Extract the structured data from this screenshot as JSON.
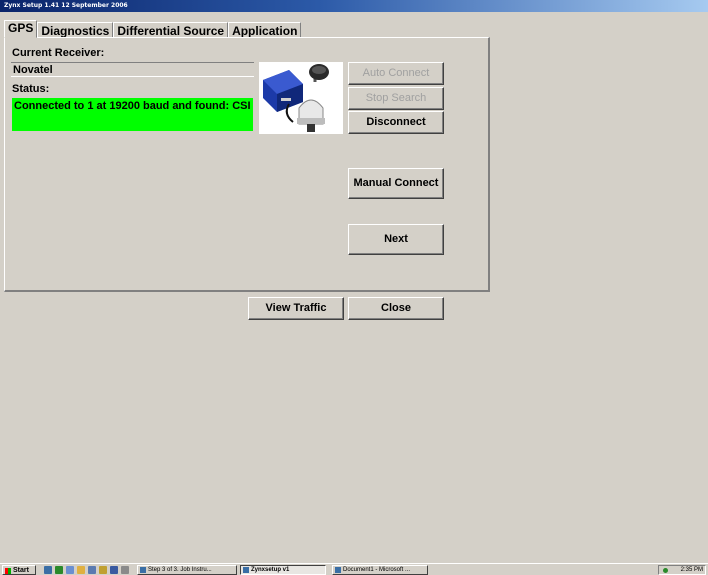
{
  "window": {
    "title": "Zynx Setup 1.41 12 September 2006"
  },
  "tabs": [
    {
      "label": "GPS"
    },
    {
      "label": "Diagnostics"
    },
    {
      "label": "Differential Source"
    },
    {
      "label": "Application"
    }
  ],
  "gps": {
    "current_receiver_label": "Current Receiver:",
    "current_receiver_value": "Novatel",
    "status_label": "Status:",
    "status_value": "Connected to 1 at 19200 baud and found: CSI",
    "status_color": "#00ff00"
  },
  "buttons": {
    "auto_connect": "Auto Connect",
    "stop_search": "Stop Search",
    "disconnect": "Disconnect",
    "manual_connect": "Manual Connect",
    "next": "Next",
    "view_traffic": "View Traffic",
    "close": "Close"
  },
  "taskbar": {
    "start_label": "Start",
    "tasks": [
      {
        "label": "Step 3 of 3.  Job Instru..."
      },
      {
        "label": "Zynxsetup v1"
      },
      {
        "label": "Document1 - Microsoft ..."
      }
    ],
    "clock": "2:35 PM"
  },
  "icons": {
    "device": "gps-receiver-and-antenna-image"
  }
}
